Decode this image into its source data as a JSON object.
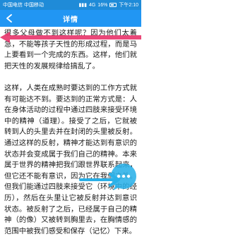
{
  "status_bar": {
    "carrier": "中国电信 中国移动",
    "signal": "4G",
    "battery_percent": "16%",
    "time": "下午2:10"
  },
  "app_bar": {
    "title": "详情"
  },
  "article": {
    "paragraphs": [
      "很多父母做不到这样呢？因为他们太着急，不能等孩子天性的形成过程，而是马上要看到一个完成的东西。这样，他们就把天性的发展规律给搞乱了。",
      "这样，人类在成熟时要达到的工作方式就有可能达不到。要达到的正常方式是：人在身体活动的过程中通过四肢来接受环境中的精神（道理）。接受了之后，它就被转到人的头里去并在封闭的头里被反射。通过这样的反射，精神才能达到有意识的状态并会变成属于我们自己的精神。本来属于世界的精神把我们跟世界联系起来，但它还不能有意识，因为它在我们之外。但我们能通过四肢来接受它（环境中的经历），然后在头里让它被反射并达到意识状态。被反射了之后，已经属于自己的精神（的像）又被转到胸里去，在胸情感的范围中被我们感受和保存（记忆）下来。"
    ]
  },
  "colors": {
    "status_bar": "#1f8bd8",
    "app_bar": "#2196f3",
    "arrow_overlay": "#e8386e",
    "bubble_overlay": "#2ab0e8"
  },
  "icons": {
    "back": "back-arrow-icon",
    "signal": "signal-icon",
    "battery": "battery-icon",
    "overlay_arrow": "left-arrow-annotation-icon",
    "overlay_bubble": "chat-bubble-icon"
  }
}
